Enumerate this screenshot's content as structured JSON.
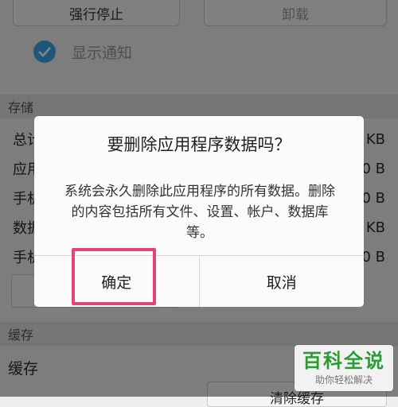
{
  "background": {
    "top_buttons": {
      "force_stop": "强行停止",
      "uninstall": "卸载"
    },
    "notification_label": "显示通知",
    "storage_header": "存储",
    "storage_rows": [
      {
        "label": "总计",
        "value": "KB"
      },
      {
        "label": "应用",
        "value": "0 B"
      },
      {
        "label": "手机",
        "value": "0 B"
      },
      {
        "label": "数据",
        "value": "KB"
      },
      {
        "label": "手机",
        "value": "0 B"
      }
    ],
    "cache_header": "缓存",
    "cache_label": "缓存",
    "clear_cache_button": "清除缓存"
  },
  "dialog": {
    "title": "要删除应用程序数据吗？",
    "message": "系统会永久删除此应用程序的所有数据。删除的内容包括所有文件、设置、帐户、数据库等。",
    "confirm": "确定",
    "cancel": "取消"
  },
  "watermark": {
    "main": "百科全说",
    "sub": "助你轻松解决"
  },
  "colors": {
    "accent_blue": "#3aa7e4",
    "highlight": "#e2437a",
    "watermark_green": "#2c9b37"
  }
}
